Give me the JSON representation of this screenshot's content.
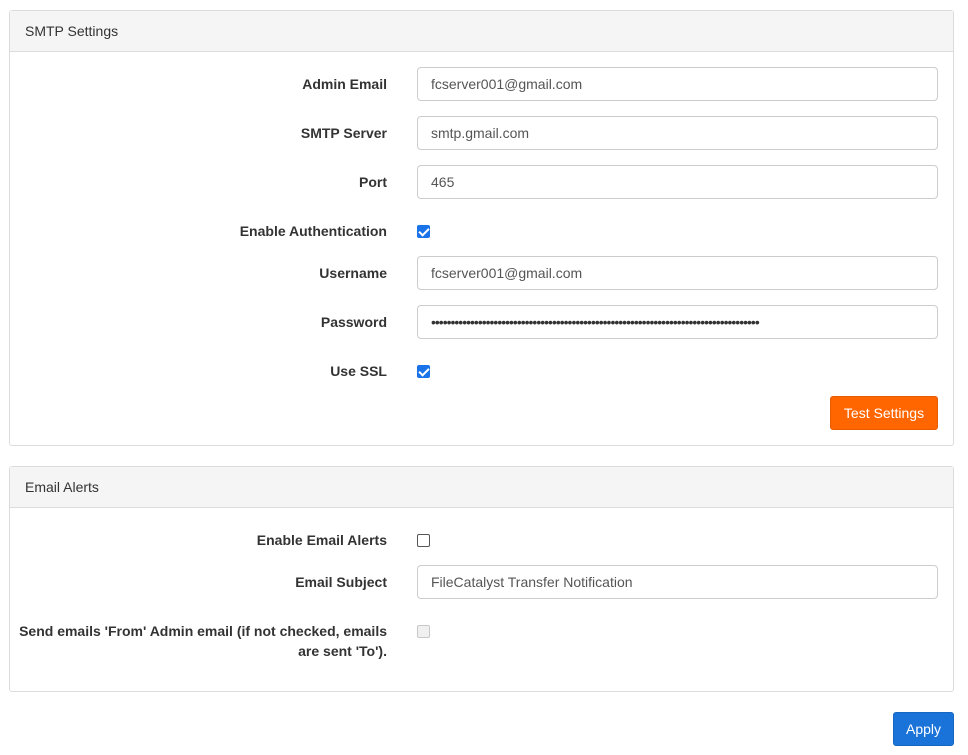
{
  "smtp": {
    "heading": "SMTP Settings",
    "admin_email": {
      "label": "Admin Email",
      "value": "fcserver001@gmail.com"
    },
    "smtp_server": {
      "label": "SMTP Server",
      "value": "smtp.gmail.com"
    },
    "port": {
      "label": "Port",
      "value": "465"
    },
    "enable_auth": {
      "label": "Enable Authentication",
      "checked": true
    },
    "username": {
      "label": "Username",
      "value": "fcserver001@gmail.com"
    },
    "password": {
      "label": "Password",
      "value": "••••••••••••••••••••••••••••••••••••••••••••••••••••••••••••••••••••••••••••••••••••"
    },
    "use_ssl": {
      "label": "Use SSL",
      "checked": true
    },
    "test_button": "Test Settings"
  },
  "alerts": {
    "heading": "Email Alerts",
    "enable_alerts": {
      "label": "Enable Email Alerts",
      "checked": false
    },
    "subject": {
      "label": "Email Subject",
      "value": "FileCatalyst Transfer Notification"
    },
    "send_from": {
      "label_line1": "Send emails 'From' Admin email (if not checked, emails",
      "label_line2": "are sent 'To').",
      "checked": false,
      "disabled": true
    }
  },
  "apply_button": "Apply",
  "colors": {
    "primary_action": "#ff6600",
    "apply": "#1a73d9",
    "checkbox": "#1a73e8"
  }
}
